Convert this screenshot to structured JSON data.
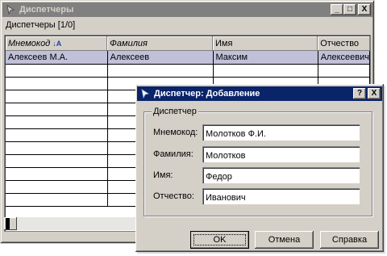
{
  "window": {
    "title": "Диспетчеры",
    "minimize": "_",
    "maximize": "□",
    "close": "X",
    "caption": "Диспетчеры [1/0]"
  },
  "grid": {
    "columns": [
      "Мнемокод",
      "Фамилия",
      "Имя",
      "Отчество"
    ],
    "sort_column": "Мнемокод",
    "rows": [
      [
        "Алексеев М.А.",
        "Алексеев",
        "Максим",
        "Алексеевич"
      ],
      [
        "",
        "",
        "",
        ""
      ],
      [
        "",
        "",
        "",
        ""
      ],
      [
        "",
        "",
        "",
        ""
      ],
      [
        "",
        "",
        "",
        ""
      ],
      [
        "",
        "",
        "",
        ""
      ],
      [
        "",
        "",
        "",
        ""
      ],
      [
        "",
        "",
        "",
        ""
      ],
      [
        "",
        "",
        "",
        ""
      ],
      [
        "",
        "",
        "",
        ""
      ],
      [
        "",
        "",
        "",
        ""
      ],
      [
        "",
        "",
        "",
        ""
      ]
    ]
  },
  "dialog": {
    "title": "Диспетчер: Добавление",
    "help": "?",
    "close": "X",
    "group_label": "Диспетчер",
    "fields": [
      {
        "label": "Мнемокод:",
        "value": "Молотков Ф.И."
      },
      {
        "label": "Фамилия:",
        "value": "Молотков"
      },
      {
        "label": "Имя:",
        "value": "Федор"
      },
      {
        "label": "Отчество:",
        "value": "Иванович"
      }
    ],
    "ok": "OK",
    "cancel": "Отмена",
    "help_button": "Справка"
  },
  "colors": {
    "active_title": "#0a246a",
    "inactive_title": "#808080",
    "selected_row": "#c0c0d8"
  }
}
